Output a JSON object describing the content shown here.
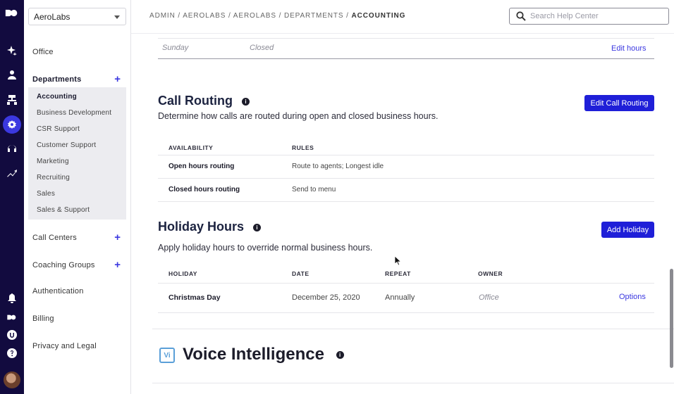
{
  "rail": {
    "icons": [
      "logo-icon",
      "sparkle-icon",
      "person-icon",
      "org-chart-icon",
      "settings-icon",
      "headset-icon",
      "analytics-icon",
      "bell-icon",
      "logo-small-icon",
      "tip-icon",
      "help-icon",
      "avatar"
    ]
  },
  "sidebar": {
    "org_selected": "AeroLabs",
    "items": {
      "office": "Office",
      "departments": "Departments",
      "call_centers": "Call Centers",
      "coaching_groups": "Coaching Groups",
      "authentication": "Authentication",
      "billing": "Billing",
      "privacy": "Privacy and Legal"
    },
    "departments": [
      "Accounting",
      "Business Development",
      "CSR Support",
      "Customer Support",
      "Marketing",
      "Recruiting",
      "Sales",
      "Sales & Support"
    ]
  },
  "header": {
    "breadcrumb_prefix": "ADMIN / AEROLABS / AEROLABS / DEPARTMENTS / ",
    "breadcrumb_current": "ACCOUNTING",
    "search_placeholder": "Search Help Center"
  },
  "hours": {
    "day": "Sunday",
    "status": "Closed",
    "edit_link": "Edit hours"
  },
  "call_routing": {
    "title": "Call Routing",
    "description": "Determine how calls are routed during open and closed business hours.",
    "button": "Edit Call Routing",
    "col_availability": "AVAILABILITY",
    "col_rules": "RULES",
    "rows": [
      {
        "availability": "Open hours routing",
        "rule": "Route to agents; Longest idle"
      },
      {
        "availability": "Closed hours routing",
        "rule": "Send to menu"
      }
    ]
  },
  "holiday_hours": {
    "title": "Holiday Hours",
    "description": "Apply holiday hours to override normal business hours.",
    "button": "Add Holiday",
    "col_holiday": "HOLIDAY",
    "col_date": "DATE",
    "col_repeat": "REPEAT",
    "col_owner": "OWNER",
    "rows": [
      {
        "holiday": "Christmas Day",
        "date": "December 25, 2020",
        "repeat": "Annually",
        "owner": "Office",
        "action": "Options"
      }
    ]
  },
  "voice_intelligence": {
    "logo": "Vi",
    "title": "Voice Intelligence"
  }
}
